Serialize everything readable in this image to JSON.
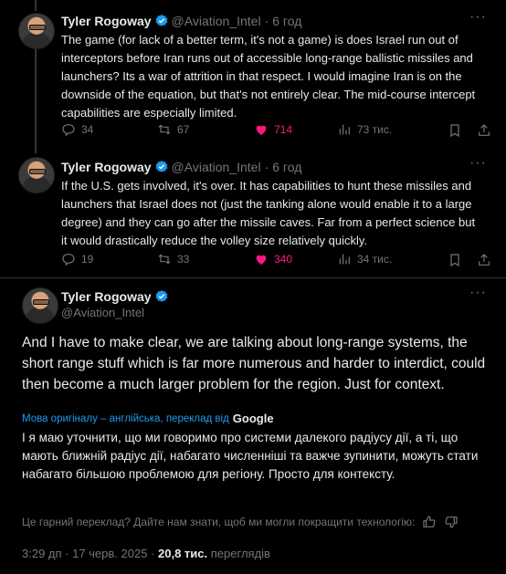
{
  "tweets": [
    {
      "name": "Tyler Rogoway",
      "handle": "@Aviation_Intel",
      "time": "6 год",
      "text": "The game (for lack of a better term, it's not a game) is does Israel run out of interceptors before Iran runs out of accessible long-range ballistic missiles and launchers? Its a war of attrition in that respect. I would imagine Iran is on the downside of the equation, but that's not entirely clear. The mid-course intercept capabilities are especially limited.",
      "replies": "34",
      "reposts": "67",
      "likes": "714",
      "views": "73 тис."
    },
    {
      "name": "Tyler Rogoway",
      "handle": "@Aviation_Intel",
      "time": "6 год",
      "text": "If the U.S. gets involved, it's over. It has capabilities to hunt these missiles and launchers that Israel does not (just the tanking alone would enable it to a large degree) and they can go after the missile caves. Far from a perfect science but it would drastically reduce the volley size relatively quickly.",
      "replies": "19",
      "reposts": "33",
      "likes": "340",
      "views": "34 тис."
    }
  ],
  "main": {
    "name": "Tyler Rogoway",
    "handle": "@Aviation_Intel",
    "text": "And I have to make clear, we are talking about long-range systems, the short range stuff which is far more numerous and harder to interdict, could then become a much larger problem for the region. Just for context.",
    "translation_label": "Мова оригіналу – англійська, переклад від",
    "translation_provider": "Google",
    "translation_text": "І я маю уточнити, що ми говоримо про системи далекого радіусу дії, а ті, що мають ближній радіус дії, набагато численніші та важче зупинити, можуть стати набагато більшою проблемою для регіону. Просто для контексту.",
    "feedback": "Це гарний переклад? Дайте нам знати, щоб ми могли покращити технологію:",
    "timestamp": "3:29 дп · 17 черв. 2025 ·",
    "views_count": "20,8 тис.",
    "views_label": "переглядів"
  },
  "colors": {
    "background": "#000000",
    "text": "#e7e9ea",
    "muted": "#71767b",
    "like": "#f91880",
    "link": "#1d9bf0",
    "verified": "#1d9bf0"
  },
  "icons": [
    "verified-badge-icon",
    "more-icon",
    "reply-icon",
    "repost-icon",
    "like-icon",
    "views-icon",
    "bookmark-icon",
    "share-icon",
    "thumbs-up-icon",
    "thumbs-down-icon"
  ]
}
